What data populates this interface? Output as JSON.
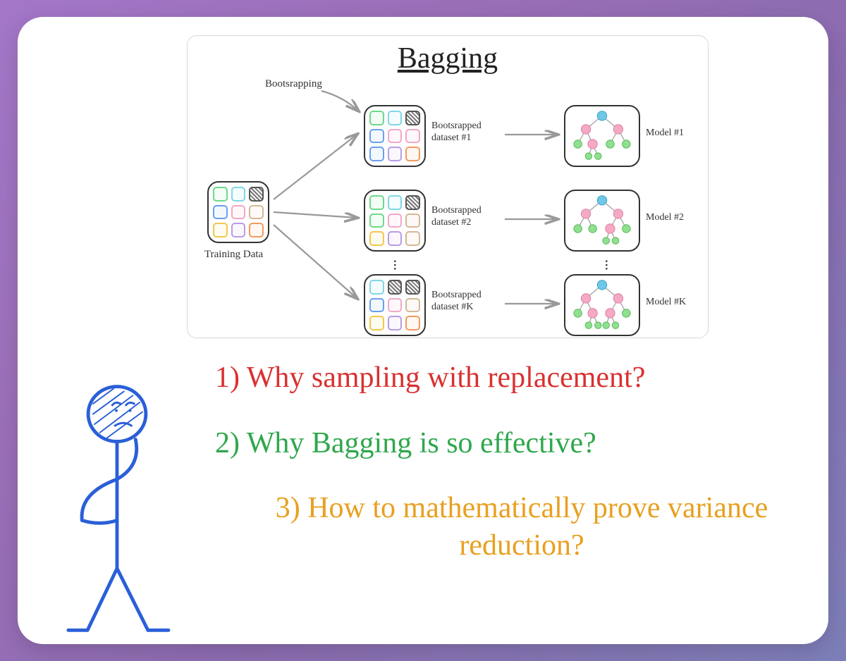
{
  "diagram": {
    "title": "Bagging",
    "bootstrap_label": "Bootsrapping",
    "training_data_label": "Training Data",
    "datasets": [
      {
        "label_line1": "Bootsrapped",
        "label_line2": "dataset #1"
      },
      {
        "label_line1": "Bootsrapped",
        "label_line2": "dataset #2"
      },
      {
        "label_line1": "Bootsrapped",
        "label_line2": "dataset #K"
      }
    ],
    "models": [
      {
        "label": "Model #1"
      },
      {
        "label": "Model #2"
      },
      {
        "label": "Model #K"
      }
    ],
    "vdots": "···"
  },
  "questions": {
    "q1": "1) Why sampling with replacement?",
    "q2": "2) Why Bagging is so effective?",
    "q3": "3) How to mathematically prove variance reduction?"
  },
  "colors": {
    "q1": "#d93030",
    "q2": "#2fa74d",
    "q3": "#e8a020",
    "stick": "#2a5fd8"
  }
}
